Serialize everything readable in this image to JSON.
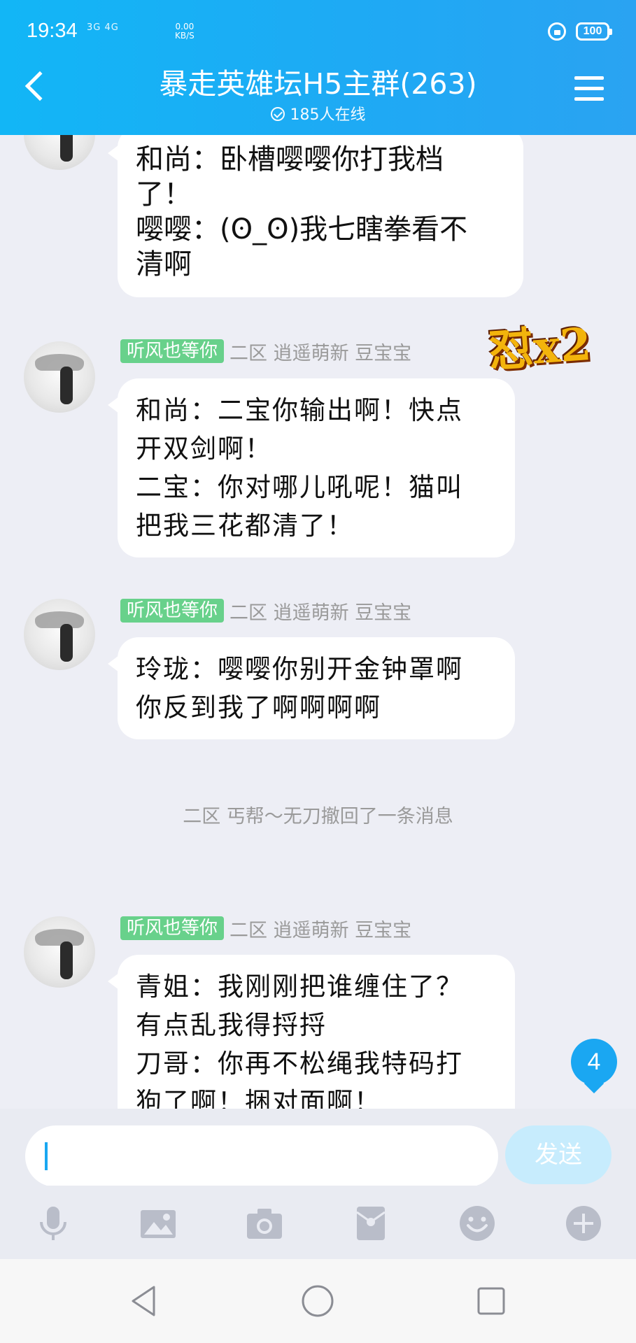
{
  "status_bar": {
    "time": "19:34",
    "network": "3G  4G",
    "speed_value": "0.00",
    "speed_unit": "KB/S",
    "battery": "100"
  },
  "header": {
    "title": "暴走英雄坛H5主群(263)",
    "online": "185人在线"
  },
  "messages": [
    {
      "lines": [
        "和尚：卧槽嘤嘤你打我档",
        "了！",
        "嘤嘤：(ʘ_ʘ)我七瞎拳看不",
        "清啊"
      ]
    },
    {
      "sender_tag": "听风也等你",
      "sender_meta": "二区 逍遥萌新 豆宝宝",
      "lines": [
        "和尚：二宝你输出啊！快点",
        "开双剑啊！",
        "二宝：你对哪儿吼呢！猫叫",
        "把我三花都清了！"
      ]
    },
    {
      "sender_tag": "听风也等你",
      "sender_meta": "二区 逍遥萌新 豆宝宝",
      "lines": [
        "玲珑：嘤嘤你别开金钟罩啊",
        "你反到我了啊啊啊啊"
      ]
    },
    {
      "sender_tag": "听风也等你",
      "sender_meta": "二区 逍遥萌新 豆宝宝",
      "lines": [
        "青姐：我刚刚把谁缠住了？",
        "有点乱我得捋捋",
        "刀哥：你再不松绳我特码打",
        "狗了啊！捆对面啊！"
      ]
    }
  ],
  "system_notice": "二区 丐帮～无刀撤回了一条消息",
  "sticker_text": "怼x2",
  "unread_badge": "4",
  "composer": {
    "send_label": "发送"
  },
  "toolbar": [
    "microphone-icon",
    "image-icon",
    "camera-icon",
    "red-packet-icon",
    "emoji-icon",
    "plus-icon"
  ],
  "colors": {
    "header": "#1fb0f5",
    "tag": "#68d18b",
    "accent": "#1aa7f2",
    "send_disabled": "#c7ecfd"
  }
}
